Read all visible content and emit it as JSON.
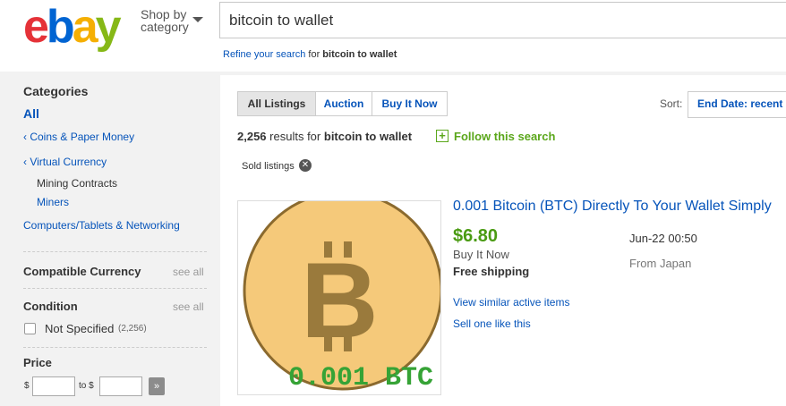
{
  "header": {
    "logo": {
      "e": "e",
      "b": "b",
      "a": "a",
      "y": "y"
    },
    "shop_by_line1": "Shop by",
    "shop_by_line2": "category",
    "search_value": "bitcoin to wallet",
    "refine_link": "Refine your search",
    "refine_for": "for",
    "refine_query": "bitcoin to wallet"
  },
  "sidebar": {
    "categories_heading": "Categories",
    "all": "All",
    "items": [
      {
        "label": "Coins & Paper Money",
        "prefix": "‹"
      },
      {
        "label": "Virtual Currency",
        "prefix": "‹"
      },
      {
        "label": "Mining Contracts"
      },
      {
        "label": "Miners"
      },
      {
        "label": "Computers/Tablets & Networking"
      }
    ],
    "compatible_currency": "Compatible Currency",
    "see_all": "see all",
    "condition": "Condition",
    "condition_option": "Not Specified",
    "condition_count": "(2,256)",
    "price": "Price",
    "price_currency": "$",
    "price_to": "to $",
    "price_go": "»"
  },
  "toolbar": {
    "tabs": [
      "All Listings",
      "Auction",
      "Buy It Now"
    ],
    "sort_label": "Sort:",
    "sort_value": "End Date: recent"
  },
  "results": {
    "count": "2,256",
    "results_for": "results for",
    "query": "bitcoin to wallet",
    "follow": "Follow this search",
    "chip": "Sold listings"
  },
  "item": {
    "title": "0.001 Bitcoin (BTC) Directly To Your Wallet Simply",
    "price": "$6.80",
    "format": "Buy It Now",
    "shipping": "Free shipping",
    "end_date": "Jun-22 00:50",
    "location": "From Japan",
    "view_similar": "View similar active items",
    "sell_one": "Sell one like this",
    "image_caption": "0.001 BTC",
    "image_symbol": "B"
  },
  "colors": {
    "link": "#0654ba",
    "price_green": "#4a9b12",
    "coin_fill": "#f5c97a",
    "coin_stroke": "#8b6a2e",
    "btc_symbol": "#9a7a3c",
    "caption_green": "#36a336"
  }
}
